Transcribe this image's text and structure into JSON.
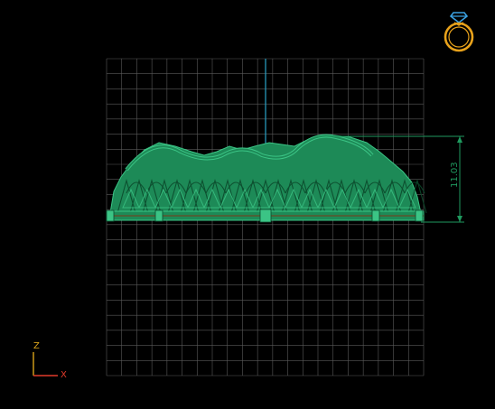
{
  "viewport": {
    "background": "#000000",
    "grid_color": "#5a5a5a",
    "grid_columns": 21,
    "grid_rows": 21
  },
  "model": {
    "color": "#1d8a57",
    "highlight": "#3bc485",
    "shadow": "#0c4a2c"
  },
  "dimension": {
    "value": "11.03",
    "color": "#1f9a5f"
  },
  "center_line": {
    "color": "#2aa3c8"
  },
  "axis_gizmo": {
    "z_label": "Z",
    "x_label": "X",
    "z_color": "#d9a21b",
    "x_color": "#e23a2a"
  },
  "view_icon": {
    "name": "ring-view-icon",
    "color": "#e8a21b",
    "gem_color": "#3aa0e0"
  }
}
